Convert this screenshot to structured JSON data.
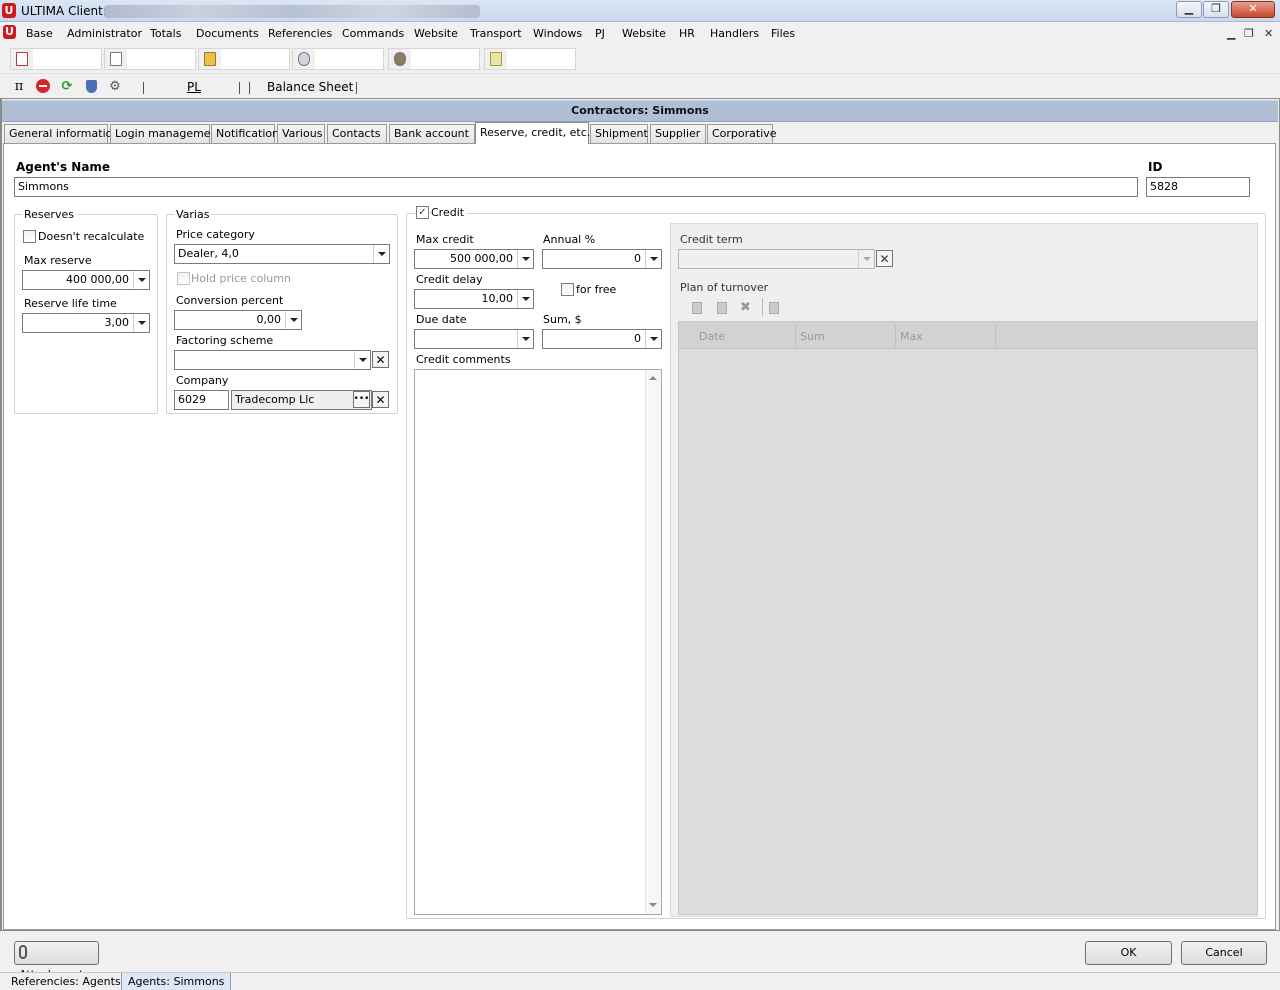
{
  "window": {
    "title": "ULTIMA Client:",
    "min_icon": "minimize-icon",
    "max_icon": "restore-icon",
    "close_icon": "close-icon"
  },
  "menu": [
    "Base",
    "Administrator",
    "Totals",
    "Documents",
    "Referencies",
    "Commands",
    "Website",
    "Transport",
    "Windows",
    "PJ",
    "Website",
    "HR",
    "Handlers",
    "Files"
  ],
  "toolbar2": {
    "pl": "PL",
    "balance_sheet": "Balance Sheet"
  },
  "header": {
    "title": "Contractors: Simmons"
  },
  "tabs": [
    "General information",
    "Login management",
    "Notification",
    "Various",
    "Contacts",
    "Bank account",
    "Reserve, credit, etc.",
    "Shipment",
    "Supplier",
    "Corporative"
  ],
  "active_tab": "Reserve, credit, etc.",
  "agent": {
    "name_label": "Agent's Name",
    "name": "Simmons",
    "id_label": "ID",
    "id": "5828"
  },
  "reserves": {
    "title": "Reserves",
    "doesnt_recalculate": "Doesn't recalculate",
    "max_reserve_label": "Max reserve",
    "max_reserve": "400 000,00",
    "life_time_label": "Reserve life time",
    "life_time": "3,00"
  },
  "varias": {
    "title": "Varias",
    "price_category_label": "Price category",
    "price_category": "Dealer, 4,0",
    "hold_price_column": "Hold price column",
    "conversion_label": "Conversion percent",
    "conversion": "0,00",
    "factoring_label": "Factoring scheme",
    "factoring": "",
    "company_label": "Company",
    "company_id": "6029",
    "company_name": "Tradecomp Llc"
  },
  "credit": {
    "title": "Credit",
    "checked": true,
    "max_credit_label": "Max credit",
    "max_credit": "500 000,00",
    "annual_label": "Annual %",
    "annual": "0",
    "delay_label": "Credit delay",
    "delay": "10,00",
    "for_free": "for free",
    "due_date_label": "Due date",
    "due_date": "",
    "sum_label": "Sum, $",
    "sum": "0",
    "comments_label": "Credit comments",
    "term_label": "Credit term",
    "plan_label": "Plan of turnover",
    "plan_columns": [
      "Date",
      "Sum",
      "Max"
    ]
  },
  "footer": {
    "attachments": "Attachments",
    "ok": "OK",
    "cancel": "Cancel"
  },
  "statusbar": [
    "Referencies: Agents",
    "Agents: Simmons"
  ]
}
